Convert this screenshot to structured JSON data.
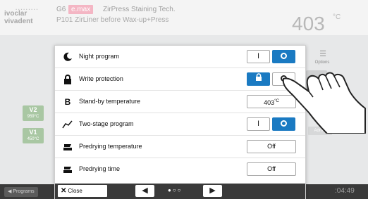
{
  "header": {
    "logo_line1": "ivoclar",
    "logo_line2": "vivadent",
    "program_code": "G6",
    "program_brand": "e.max",
    "program_name": "ZirPress Staining Tech.",
    "program_subtitle": "P101  ZirLiner before Wax-up+Press",
    "temperature": "403",
    "temperature_unit": "°C"
  },
  "background": {
    "tiles": [
      {
        "label": "V2",
        "value": "959°C"
      },
      {
        "label": "V1",
        "value": "450°C"
      }
    ],
    "options_label": "Options",
    "admin_label": "Admin"
  },
  "dialog": {
    "rows": [
      {
        "label": "Night program",
        "icon": "night-icon",
        "control": "toggle",
        "off_label": "I",
        "on_label": "O",
        "active": "right"
      },
      {
        "label": "Write protection",
        "icon": "lock-icon",
        "control": "toggle",
        "left_symbol": "lock",
        "right_symbol": "ring",
        "active": "left"
      },
      {
        "label": "Stand-by temperature",
        "icon": "b-icon",
        "control": "value",
        "value": "403",
        "unit": "°C"
      },
      {
        "label": "Two-stage program",
        "icon": "two-stage-icon",
        "control": "toggle",
        "off_label": "I",
        "on_label": "O",
        "active": "right"
      },
      {
        "label": "Predrying temperature",
        "icon": "predry-icon",
        "control": "value",
        "value": "Off"
      },
      {
        "label": "Predrying time",
        "icon": "predry-icon",
        "control": "value",
        "value": "Off"
      }
    ],
    "close_label": "Close",
    "pager": "●○○"
  },
  "footer": {
    "programs_label": "Programs",
    "clock": ":04:49"
  },
  "colors": {
    "accent_blue": "#1a7ac2",
    "tile_green": "#a9c7a3",
    "brand_pink": "#f4b6c4",
    "footer_dark": "#3a3a3a"
  }
}
